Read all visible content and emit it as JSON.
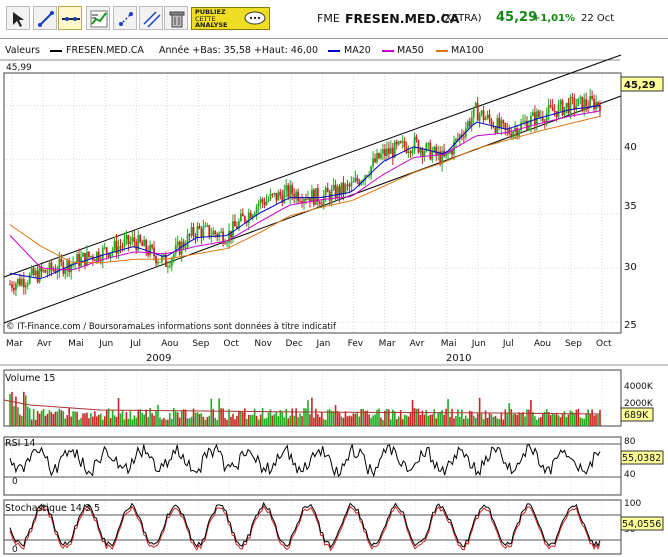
{
  "toolbar": {
    "tools": [
      "cursor-icon",
      "line-draw-icon",
      "horizontal-line-icon",
      "chart-settings-icon",
      "zoom-icon",
      "parallel-lines-icon",
      "trash-icon"
    ],
    "promo_lines": [
      "PUBLIEZ",
      "CETTE",
      "ANALYSE"
    ]
  },
  "header": {
    "code": "FME",
    "name": "FRESEN.MED.CA",
    "market": "(XETRA)",
    "price": "45,29",
    "change": "+1,01%",
    "date": "22 Oct"
  },
  "legend": {
    "valeurs": "Valeurs",
    "security": "FRESEN.MED.CA",
    "range": "Année +Bas: 35,58 +Haut: 46,00",
    "ma20": "MA20",
    "ma50": "MA50",
    "ma100": "MA100",
    "colors": {
      "security": "#000000",
      "ma20": "#0000cc",
      "ma50": "#cc00cc",
      "ma100": "#dd7711"
    }
  },
  "main": {
    "top_value": "45,99",
    "price_tag": "45,29",
    "credit": "© IT-Finance.com / BoursoramaLes informations sont données à titre indicatif",
    "yticks": [
      "25",
      "30",
      "35",
      "40"
    ],
    "months": [
      "Mar",
      "Avr",
      "Mai",
      "Jun",
      "Jul",
      "Aou",
      "Sep",
      "Oct",
      "Nov",
      "Dec",
      "Jan",
      "Fev",
      "Mar",
      "Avr",
      "Mai",
      "Jun",
      "Jul",
      "Aou",
      "Sep",
      "Oct"
    ],
    "years": [
      "2009",
      "2010"
    ]
  },
  "volume": {
    "title": "Volume 15",
    "ticks": [
      "4000K",
      "2000K"
    ],
    "tag": "689K"
  },
  "rsi": {
    "title": "RSI 14",
    "ticks": [
      "80",
      "40",
      "0"
    ],
    "tag": "55,0382"
  },
  "stoch": {
    "title": "Stochastique 14 3 5",
    "ticks": [
      "100",
      "50",
      "0"
    ],
    "tag": "54,0556"
  },
  "chart_data": {
    "type": "line",
    "title": "FRESEN.MED.CA",
    "x": [
      "2009-03",
      "2009-04",
      "2009-05",
      "2009-06",
      "2009-07",
      "2009-08",
      "2009-09",
      "2009-10",
      "2009-11",
      "2009-12",
      "2010-01",
      "2010-02",
      "2010-03",
      "2010-04",
      "2010-05",
      "2010-06",
      "2010-07",
      "2010-08",
      "2010-09",
      "2010-10"
    ],
    "series": [
      {
        "name": "FRESEN.MED.CA",
        "values": [
          28.5,
          29.5,
          30.5,
          31.5,
          32.5,
          30.5,
          33.5,
          33.0,
          36.0,
          37.0,
          36.5,
          37.5,
          40.5,
          41.5,
          40.0,
          44.5,
          42.5,
          44.0,
          45.0,
          45.29
        ]
      },
      {
        "name": "MA20",
        "values": [
          29.5,
          29.0,
          30.3,
          31.2,
          32.0,
          31.0,
          32.8,
          33.0,
          35.0,
          36.5,
          36.5,
          37.0,
          39.8,
          41.2,
          40.5,
          43.5,
          42.8,
          43.8,
          44.6,
          45.0
        ]
      },
      {
        "name": "MA50",
        "values": [
          33.0,
          30.0,
          29.8,
          30.8,
          31.5,
          31.3,
          32.0,
          32.5,
          34.2,
          35.8,
          36.3,
          36.6,
          38.6,
          40.2,
          40.5,
          42.2,
          42.5,
          43.3,
          44.0,
          44.5
        ]
      },
      {
        "name": "MA100",
        "values": [
          34.0,
          32.0,
          30.5,
          30.5,
          30.8,
          30.8,
          31.3,
          31.8,
          33.2,
          34.8,
          35.6,
          36.2,
          37.5,
          38.8,
          39.8,
          41.0,
          41.8,
          42.6,
          43.3,
          44.0
        ]
      }
    ],
    "ylim": [
      24,
      48
    ],
    "grid": true,
    "legend_placement": "top"
  }
}
